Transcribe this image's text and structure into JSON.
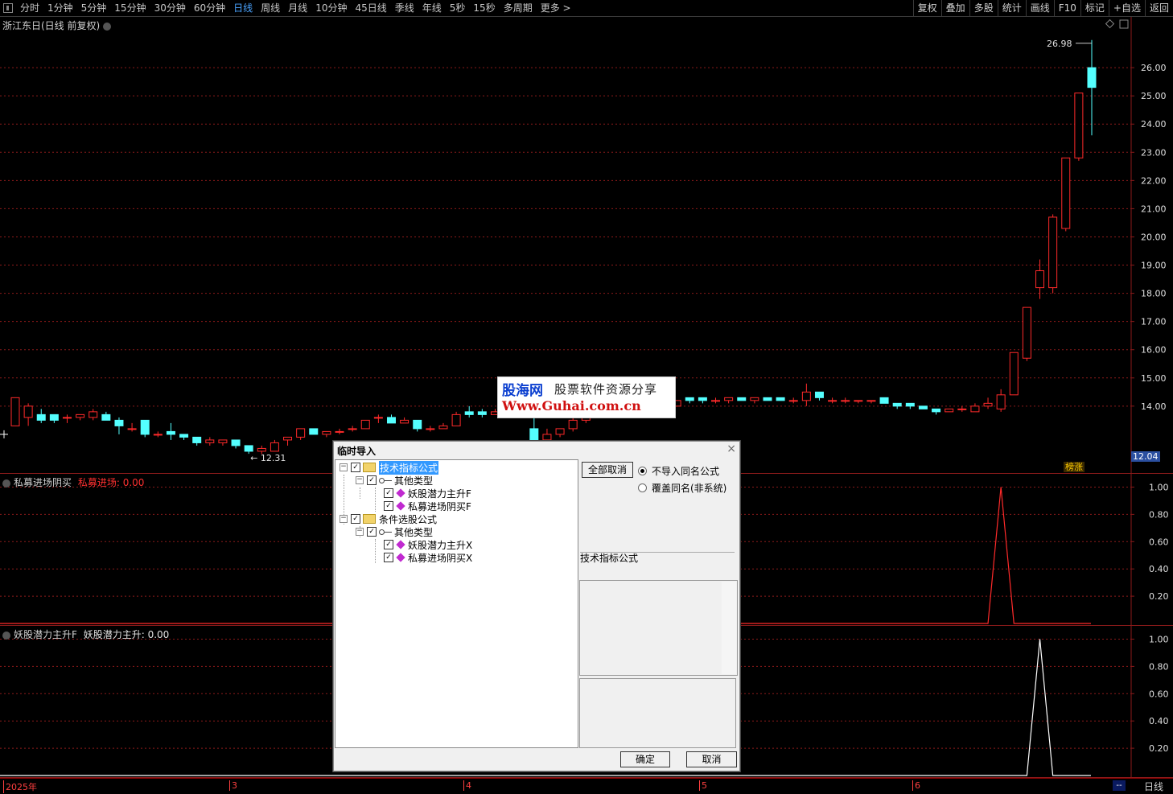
{
  "toolbar": {
    "periods": [
      "分时",
      "1分钟",
      "5分钟",
      "15分钟",
      "30分钟",
      "60分钟",
      "日线",
      "周线",
      "月线",
      "10分钟",
      "45日线",
      "季线",
      "年线",
      "5秒",
      "15秒",
      "多周期",
      "更多 >"
    ],
    "active_period": "日线",
    "right_buttons": [
      "复权",
      "叠加",
      "多股",
      "统计",
      "画线",
      "F10",
      "标记",
      "+自选",
      "返回"
    ]
  },
  "main_chart": {
    "title": "浙江东日(日线 前复权)",
    "high_label": "26.98",
    "low_label": "12.31",
    "last_price": "12.04",
    "rank_badge": "榜涨"
  },
  "indicator1": {
    "name": "私募进场阴买",
    "series_label": "私募进场: 0.00"
  },
  "indicator2": {
    "name": "妖股潜力主升F",
    "series_label": "妖股潜力主升: 0.00"
  },
  "x_axis": {
    "labels": [
      "2025年",
      "3",
      "4",
      "5",
      "6"
    ],
    "period_label": "日线",
    "dash": "--"
  },
  "watermark": {
    "brand": "股海网",
    "slogan": "股票软件资源分享",
    "url": "Www.Guhai.com.cn"
  },
  "dialog": {
    "title": "临时导入",
    "close": "×",
    "tree": {
      "group1": "技术指标公式",
      "group1_sub": "其他类型",
      "group1_items": [
        "妖股潜力主升F",
        "私募进场阴买F"
      ],
      "group2": "条件选股公式",
      "group2_sub": "其他类型",
      "group2_items": [
        "妖股潜力主升X",
        "私募进场阴买X"
      ]
    },
    "cancel_all_label": "全部取消",
    "radio1": "不导入同名公式",
    "radio2": "覆盖同名(非系统)",
    "type_label": "技术指标公式",
    "ok_label": "确定",
    "cancel_label": "取消"
  },
  "chart_data": [
    {
      "type": "candlestick",
      "title": "浙江东日(日线 前复权)",
      "y_ticks": [
        14.0,
        15.0,
        16.0,
        17.0,
        18.0,
        19.0,
        20.0,
        21.0,
        22.0,
        23.0,
        24.0,
        25.0,
        26.0
      ],
      "ylim": [
        11.6,
        27.8
      ],
      "x_labels": [
        "2025年",
        "3",
        "4",
        "5",
        "6"
      ],
      "candles": [
        {
          "o": 13.3,
          "c": 14.3,
          "h": 14.3,
          "l": 13.3
        },
        {
          "o": 13.6,
          "c": 14.0,
          "h": 14.1,
          "l": 13.3
        },
        {
          "o": 13.7,
          "c": 13.5,
          "h": 13.9,
          "l": 13.4
        },
        {
          "o": 13.7,
          "c": 13.5,
          "h": 13.7,
          "l": 13.4
        },
        {
          "o": 13.6,
          "c": 13.6,
          "h": 13.7,
          "l": 13.4
        },
        {
          "o": 13.6,
          "c": 13.7,
          "h": 13.7,
          "l": 13.5
        },
        {
          "o": 13.6,
          "c": 13.8,
          "h": 13.9,
          "l": 13.5
        },
        {
          "o": 13.7,
          "c": 13.5,
          "h": 13.8,
          "l": 13.5
        },
        {
          "o": 13.5,
          "c": 13.3,
          "h": 13.6,
          "l": 13.0
        },
        {
          "o": 13.2,
          "c": 13.2,
          "h": 13.4,
          "l": 13.1
        },
        {
          "o": 13.5,
          "c": 13.0,
          "h": 13.5,
          "l": 12.9
        },
        {
          "o": 13.0,
          "c": 13.0,
          "h": 13.1,
          "l": 12.9
        },
        {
          "o": 13.1,
          "c": 13.0,
          "h": 13.4,
          "l": 12.8
        },
        {
          "o": 13.0,
          "c": 12.9,
          "h": 13.0,
          "l": 12.8
        },
        {
          "o": 12.9,
          "c": 12.7,
          "h": 12.9,
          "l": 12.6
        },
        {
          "o": 12.7,
          "c": 12.8,
          "h": 12.9,
          "l": 12.6
        },
        {
          "o": 12.7,
          "c": 12.8,
          "h": 12.8,
          "l": 12.6
        },
        {
          "o": 12.8,
          "c": 12.6,
          "h": 12.8,
          "l": 12.5
        },
        {
          "o": 12.6,
          "c": 12.4,
          "h": 12.6,
          "l": 12.31
        },
        {
          "o": 12.4,
          "c": 12.5,
          "h": 12.6,
          "l": 12.3
        },
        {
          "o": 12.4,
          "c": 12.7,
          "h": 12.8,
          "l": 12.4
        },
        {
          "o": 12.8,
          "c": 12.9,
          "h": 12.9,
          "l": 12.6
        },
        {
          "o": 12.9,
          "c": 13.2,
          "h": 13.2,
          "l": 12.8
        },
        {
          "o": 13.2,
          "c": 13.0,
          "h": 13.2,
          "l": 13.0
        },
        {
          "o": 13.0,
          "c": 13.1,
          "h": 13.1,
          "l": 12.9
        },
        {
          "o": 13.1,
          "c": 13.1,
          "h": 13.2,
          "l": 13.0
        },
        {
          "o": 13.2,
          "c": 13.2,
          "h": 13.3,
          "l": 13.1
        },
        {
          "o": 13.2,
          "c": 13.5,
          "h": 13.5,
          "l": 13.2
        },
        {
          "o": 13.6,
          "c": 13.6,
          "h": 13.7,
          "l": 13.4
        },
        {
          "o": 13.6,
          "c": 13.4,
          "h": 13.7,
          "l": 13.4
        },
        {
          "o": 13.4,
          "c": 13.5,
          "h": 13.6,
          "l": 13.4
        },
        {
          "o": 13.5,
          "c": 13.2,
          "h": 13.5,
          "l": 13.1
        },
        {
          "o": 13.2,
          "c": 13.2,
          "h": 13.3,
          "l": 13.1
        },
        {
          "o": 13.2,
          "c": 13.3,
          "h": 13.4,
          "l": 13.2
        },
        {
          "o": 13.3,
          "c": 13.7,
          "h": 13.8,
          "l": 13.3
        },
        {
          "o": 13.8,
          "c": 13.7,
          "h": 14.0,
          "l": 13.6
        },
        {
          "o": 13.8,
          "c": 13.7,
          "h": 13.9,
          "l": 13.6
        },
        {
          "o": 13.7,
          "c": 13.8,
          "h": 13.9,
          "l": 13.7
        },
        {
          "o": 13.8,
          "c": 14.1,
          "h": 14.4,
          "l": 13.8
        },
        {
          "o": 14.1,
          "c": 14.1,
          "h": 14.2,
          "l": 13.9
        },
        {
          "o": 13.2,
          "c": 12.8,
          "h": 13.7,
          "l": 12.6
        },
        {
          "o": 12.8,
          "c": 13.0,
          "h": 13.2,
          "l": 12.7
        },
        {
          "o": 13.0,
          "c": 13.2,
          "h": 13.2,
          "l": 12.9
        },
        {
          "o": 13.2,
          "c": 13.5,
          "h": 13.6,
          "l": 13.1
        },
        {
          "o": 13.5,
          "c": 13.6,
          "h": 13.8,
          "l": 13.4
        },
        {
          "o": 13.9,
          "c": 13.9,
          "h": 14.0,
          "l": 13.8
        },
        {
          "o": 13.9,
          "c": 13.9,
          "h": 14.0,
          "l": 13.8
        },
        {
          "o": 13.9,
          "c": 13.9,
          "h": 14.0,
          "l": 13.8
        },
        {
          "o": 13.9,
          "c": 13.9,
          "h": 14.0,
          "l": 13.8
        },
        {
          "o": 14.1,
          "c": 14.1,
          "h": 14.4,
          "l": 14.0
        },
        {
          "o": 14.1,
          "c": 14.1,
          "h": 14.2,
          "l": 14.0
        },
        {
          "o": 14.0,
          "c": 14.2,
          "h": 14.2,
          "l": 14.0
        },
        {
          "o": 14.3,
          "c": 14.2,
          "h": 14.3,
          "l": 14.1
        },
        {
          "o": 14.3,
          "c": 14.2,
          "h": 14.3,
          "l": 14.1
        },
        {
          "o": 14.2,
          "c": 14.2,
          "h": 14.3,
          "l": 14.1
        },
        {
          "o": 14.2,
          "c": 14.3,
          "h": 14.3,
          "l": 14.1
        },
        {
          "o": 14.3,
          "c": 14.2,
          "h": 14.3,
          "l": 14.2
        },
        {
          "o": 14.2,
          "c": 14.3,
          "h": 14.3,
          "l": 14.1
        },
        {
          "o": 14.3,
          "c": 14.2,
          "h": 14.3,
          "l": 14.2
        },
        {
          "o": 14.3,
          "c": 14.2,
          "h": 14.3,
          "l": 14.2
        },
        {
          "o": 14.2,
          "c": 14.2,
          "h": 14.3,
          "l": 14.1
        },
        {
          "o": 14.2,
          "c": 14.5,
          "h": 14.8,
          "l": 14.0
        },
        {
          "o": 14.5,
          "c": 14.3,
          "h": 14.5,
          "l": 14.2
        },
        {
          "o": 14.2,
          "c": 14.2,
          "h": 14.3,
          "l": 14.1
        },
        {
          "o": 14.2,
          "c": 14.2,
          "h": 14.3,
          "l": 14.1
        },
        {
          "o": 14.2,
          "c": 14.2,
          "h": 14.2,
          "l": 14.1
        },
        {
          "o": 14.2,
          "c": 14.2,
          "h": 14.2,
          "l": 14.1
        },
        {
          "o": 14.3,
          "c": 14.1,
          "h": 14.3,
          "l": 14.1
        },
        {
          "o": 14.1,
          "c": 14.0,
          "h": 14.1,
          "l": 13.9
        },
        {
          "o": 14.1,
          "c": 14.0,
          "h": 14.1,
          "l": 13.9
        },
        {
          "o": 14.0,
          "c": 13.9,
          "h": 14.0,
          "l": 13.9
        },
        {
          "o": 13.9,
          "c": 13.8,
          "h": 13.9,
          "l": 13.7
        },
        {
          "o": 13.8,
          "c": 13.9,
          "h": 13.9,
          "l": 13.8
        },
        {
          "o": 13.9,
          "c": 13.9,
          "h": 14.0,
          "l": 13.8
        },
        {
          "o": 13.8,
          "c": 14.0,
          "h": 14.1,
          "l": 13.8
        },
        {
          "o": 14.0,
          "c": 14.1,
          "h": 14.3,
          "l": 13.9
        },
        {
          "o": 13.9,
          "c": 14.4,
          "h": 14.6,
          "l": 13.8
        },
        {
          "o": 14.4,
          "c": 15.9,
          "h": 15.9,
          "l": 14.4
        },
        {
          "o": 15.7,
          "c": 17.5,
          "h": 17.5,
          "l": 15.6
        },
        {
          "o": 18.2,
          "c": 18.8,
          "h": 19.2,
          "l": 17.8
        },
        {
          "o": 18.2,
          "c": 20.7,
          "h": 20.8,
          "l": 18.0
        },
        {
          "o": 20.3,
          "c": 22.8,
          "h": 22.8,
          "l": 20.2
        },
        {
          "o": 22.8,
          "c": 25.1,
          "h": 25.1,
          "l": 22.7
        },
        {
          "o": 26.0,
          "c": 25.3,
          "h": 26.98,
          "l": 23.6
        }
      ]
    },
    {
      "type": "line",
      "title": "私募进场阴买",
      "series": [
        {
          "name": "私募进场",
          "values_note": "0 except single spike",
          "spike_index": 76,
          "spike_value": 1.0
        }
      ],
      "y_ticks": [
        0.2,
        0.4,
        0.6,
        0.8,
        1.0
      ],
      "ylim": [
        0,
        1.05
      ]
    },
    {
      "type": "line",
      "title": "妖股潜力主升F",
      "series": [
        {
          "name": "妖股潜力主升",
          "values_note": "0 except single spike",
          "spike_index": 79,
          "spike_value": 1.0
        }
      ],
      "y_ticks": [
        0.2,
        0.4,
        0.6,
        0.8,
        1.0
      ],
      "ylim": [
        0,
        1.05
      ]
    }
  ],
  "colors": {
    "up": "#ff2a2a",
    "down": "#54ffff",
    "grid": "#8b1a1a",
    "ind1_line": "#ff2a2a",
    "ind2_line": "#ffffff"
  }
}
